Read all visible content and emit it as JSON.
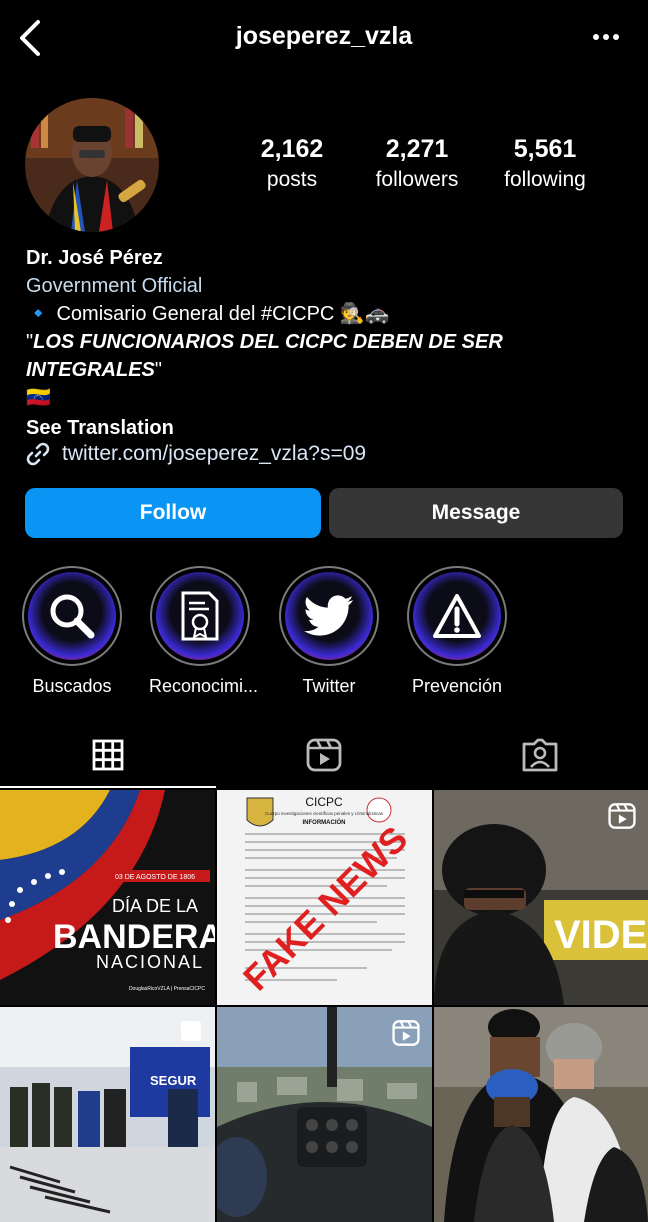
{
  "header": {
    "username": "joseperez_vzla"
  },
  "stats": [
    {
      "value": "2,162",
      "label": "posts"
    },
    {
      "value": "2,271",
      "label": "followers"
    },
    {
      "value": "5,561",
      "label": "following"
    }
  ],
  "bio": {
    "name": "Dr. José Pérez",
    "category": "Government Official",
    "line1_prefix": "🔹",
    "line1_text": "Comisario General del #CICPC",
    "line1_suffix": "🕵🚓",
    "quote": "LOS FUNCIONARIOS DEL CICPC DEBEN DE SER INTEGRALES",
    "flag": "🇻🇪",
    "see_translation": "See Translation"
  },
  "link": {
    "text": "twitter.com/joseperez_vzla?s=09"
  },
  "buttons": {
    "follow": "Follow",
    "message": "Message"
  },
  "highlights": [
    {
      "label": "Buscados",
      "icon": "magnifier-icon"
    },
    {
      "label": "Reconocimi...",
      "icon": "certificate-icon"
    },
    {
      "label": "Twitter",
      "icon": "twitter-bird-icon"
    },
    {
      "label": "Prevención",
      "icon": "warning-icon"
    }
  ],
  "tabs": [
    {
      "name": "grid",
      "icon": "grid-icon",
      "active": true
    },
    {
      "name": "reels",
      "icon": "reels-icon",
      "active": false
    },
    {
      "name": "tagged",
      "icon": "tagged-icon",
      "active": false
    }
  ],
  "posts": [
    {
      "t1": "03 DE AGOSTO DE 1806",
      "t2": "DÍA DE LA",
      "t3": "BANDERA",
      "t4": "NACIONAL",
      "t5": "DouglasRicoVZLA | PrensaCICPC"
    },
    {
      "t1": "CICPC",
      "t2": "Cuerpo investigaciones científicas penales y criminalísticas",
      "t3": "INFORMACIÓN",
      "t4": "FAKE NEWS"
    },
    {
      "t1": "VIDEN"
    },
    {
      "t1": "SEGUR"
    },
    {},
    {}
  ],
  "colors": {
    "accent": "#0a95f5",
    "button_dark": "#363636",
    "background": "#000000"
  }
}
